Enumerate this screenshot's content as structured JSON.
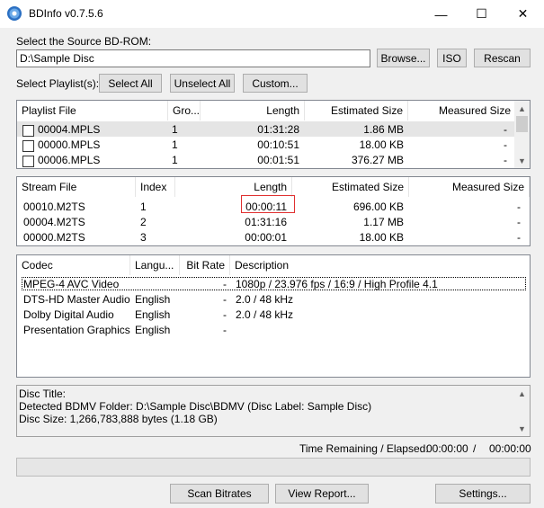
{
  "window": {
    "title": "BDInfo v0.7.5.6",
    "minimize": "—",
    "maximize": "☐",
    "close": "✕"
  },
  "source": {
    "label": "Select the Source BD-ROM:",
    "path": "D:\\Sample Disc",
    "browse": "Browse...",
    "iso": "ISO",
    "rescan": "Rescan"
  },
  "playlist_controls": {
    "label": "Select Playlist(s):",
    "select_all": "Select All",
    "unselect_all": "Unselect All",
    "custom": "Custom..."
  },
  "playlists": {
    "headers": [
      "Playlist File",
      "Gro...",
      "Length",
      "Estimated Size",
      "Measured Size"
    ],
    "rows": [
      {
        "file": "00004.MPLS",
        "group": "1",
        "length": "01:31:28",
        "est": "1.86 MB",
        "meas": "-"
      },
      {
        "file": "00000.MPLS",
        "group": "1",
        "length": "00:10:51",
        "est": "18.00 KB",
        "meas": "-"
      },
      {
        "file": "00006.MPLS",
        "group": "1",
        "length": "00:01:51",
        "est": "376.27 MB",
        "meas": "-"
      }
    ]
  },
  "streams": {
    "headers": [
      "Stream File",
      "Index",
      "Length",
      "Estimated Size",
      "Measured Size"
    ],
    "rows": [
      {
        "file": "00010.M2TS",
        "index": "1",
        "length": "00:00:11",
        "est": "696.00 KB",
        "meas": "-"
      },
      {
        "file": "00004.M2TS",
        "index": "2",
        "length": "01:31:16",
        "est": "1.17 MB",
        "meas": "-"
      },
      {
        "file": "00000.M2TS",
        "index": "3",
        "length": "00:00:01",
        "est": "18.00 KB",
        "meas": "-"
      }
    ]
  },
  "codecs": {
    "headers": [
      "Codec",
      "Langu...",
      "Bit Rate",
      "Description"
    ],
    "rows": [
      {
        "codec": "MPEG-4 AVC Video",
        "lang": "",
        "bitrate": "-",
        "desc": "1080p / 23.976 fps / 16:9 / High Profile 4.1"
      },
      {
        "codec": "DTS-HD Master Audio",
        "lang": "English",
        "bitrate": "-",
        "desc": "2.0 / 48 kHz"
      },
      {
        "codec": "Dolby Digital Audio",
        "lang": "English",
        "bitrate": "-",
        "desc": "2.0 / 48 kHz"
      },
      {
        "codec": "Presentation Graphics",
        "lang": "English",
        "bitrate": "-",
        "desc": ""
      }
    ]
  },
  "info": {
    "line1": "Disc Title:",
    "line2": "Detected BDMV Folder: D:\\Sample Disc\\BDMV (Disc Label: Sample Disc)",
    "line3": "Disc Size: 1,266,783,888 bytes (1.18 GB)"
  },
  "status": {
    "label": "Time Remaining / Elapsed:",
    "remaining": "00:00:00",
    "sep": "/",
    "elapsed": "00:00:00",
    "progress": 0
  },
  "bottom": {
    "scan": "Scan Bitrates",
    "report": "View Report...",
    "settings": "Settings..."
  },
  "highlight_color": "#e03030"
}
